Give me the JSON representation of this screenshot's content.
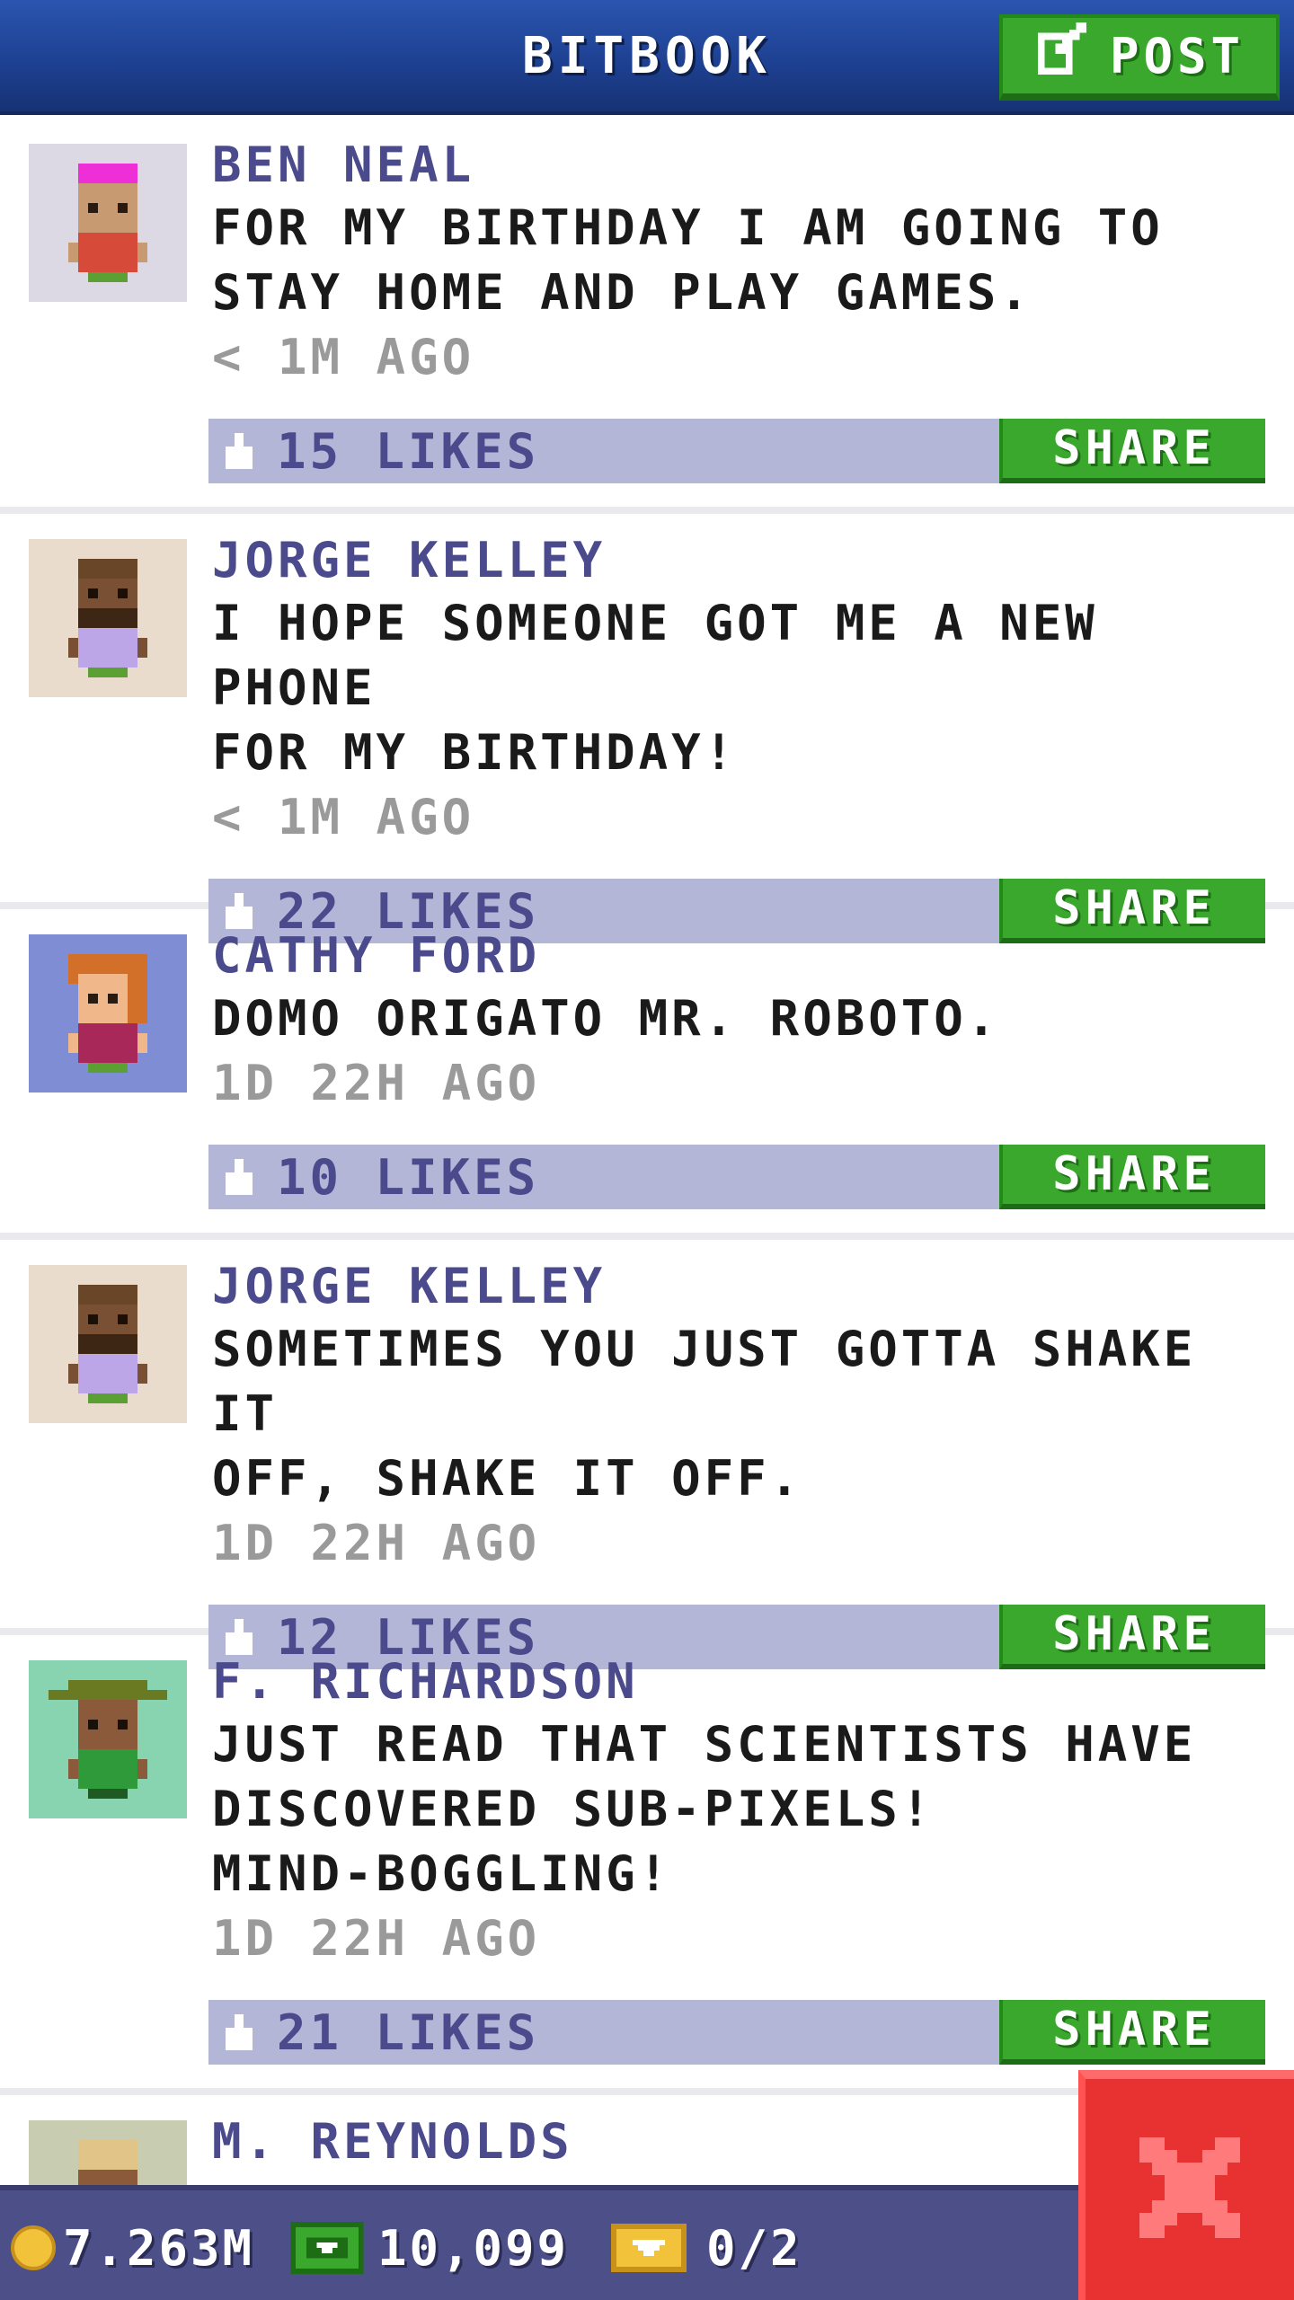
{
  "header": {
    "title": "BITBOOK",
    "post_label": "POST"
  },
  "feed": {
    "share_label": "SHARE",
    "posts": [
      {
        "author": "BEN NEAL",
        "message": "FOR MY BIRTHDAY I AM GOING TO\nSTAY HOME AND PLAY GAMES.",
        "time": "< 1M AGO",
        "likes": "15 LIKES"
      },
      {
        "author": "JORGE KELLEY",
        "message": "I HOPE SOMEONE GOT ME A NEW PHONE\nFOR MY BIRTHDAY!",
        "time": "< 1M AGO",
        "likes": "22 LIKES"
      },
      {
        "author": "CATHY FORD",
        "message": "DOMO ORIGATO MR. ROBOTO.",
        "time": "1D 22H AGO",
        "likes": "10 LIKES"
      },
      {
        "author": "JORGE KELLEY",
        "message": "SOMETIMES YOU JUST GOTTA SHAKE IT\nOFF, SHAKE IT OFF.",
        "time": "1D 22H AGO",
        "likes": "12 LIKES"
      },
      {
        "author": "F. RICHARDSON",
        "message": "JUST READ THAT SCIENTISTS HAVE\nDISCOVERED SUB-PIXELS!\nMIND-BOGGLING!",
        "time": "1D 22H AGO",
        "likes": "21 LIKES"
      },
      {
        "author": "M. REYNOLDS"
      }
    ]
  },
  "bottom_bar": {
    "coins": "7.263M",
    "bux": "10,099",
    "tickets": "0/2"
  },
  "icons": {
    "post": "edit-icon",
    "like": "thumbs-up-icon",
    "coins": "coin-icon",
    "bux": "cash-icon",
    "tickets": "ticket-icon",
    "close": "close-icon"
  },
  "colors": {
    "header": "#1d3f8f",
    "accent_green": "#3aa82c",
    "author_text": "#4a4a8c",
    "like_bar": "#b4b6d8",
    "bottom_bar": "#4d5088",
    "close_red": "#e83232"
  }
}
